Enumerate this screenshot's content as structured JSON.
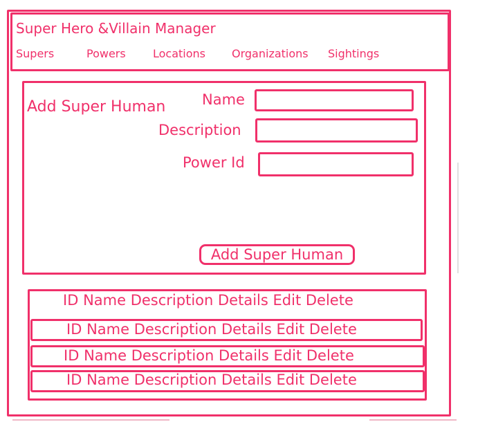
{
  "header": {
    "title": "Super Hero &Villain Manager",
    "nav": [
      "Supers",
      "Powers",
      "Locations",
      "Organizations",
      "Sightings"
    ]
  },
  "form": {
    "title": "Add Super Human",
    "fields": [
      {
        "label": "Name",
        "value": ""
      },
      {
        "label": "Description",
        "value": ""
      },
      {
        "label": "Power Id",
        "value": ""
      }
    ],
    "submit_label": "Add Super Human"
  },
  "table": {
    "header": [
      "ID",
      "Name",
      "Description",
      "Details",
      "Edit",
      "Delete"
    ],
    "rows": [
      [
        "ID",
        "Name",
        "Description",
        "Details",
        "Edit",
        "Delete"
      ],
      [
        "ID",
        "Name",
        "Description",
        "Details",
        "Edit",
        "Delete"
      ],
      [
        "ID",
        "Name",
        "Description",
        "Details",
        "Edit",
        "Delete"
      ]
    ]
  },
  "colors": {
    "accent": "#f0306a",
    "background": "#ffffff"
  }
}
